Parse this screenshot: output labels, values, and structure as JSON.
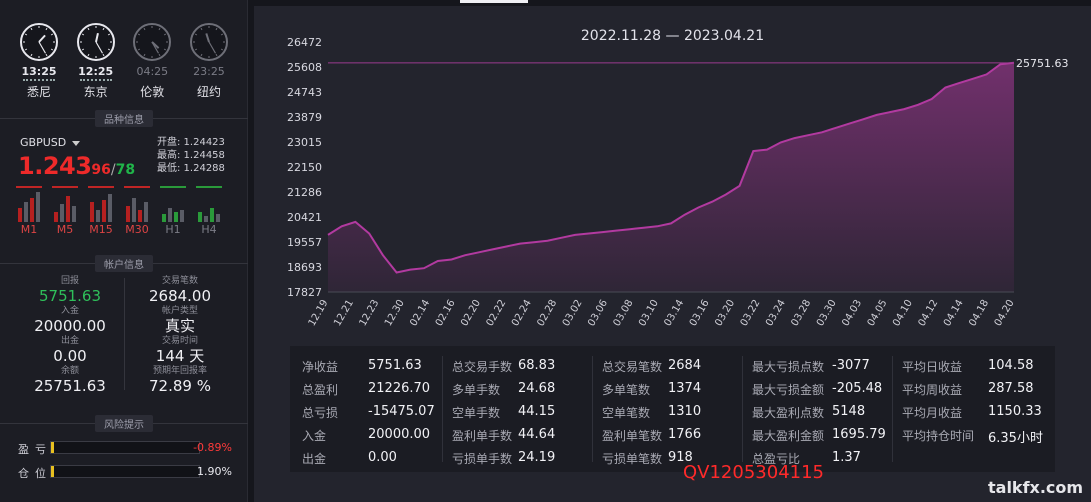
{
  "clocks": [
    {
      "time": "13:25",
      "city": "悉尼",
      "active": true,
      "h": 13,
      "m": 25
    },
    {
      "time": "12:25",
      "city": "东京",
      "active": true,
      "h": 12,
      "m": 25
    },
    {
      "time": "04:25",
      "city": "伦敦",
      "active": false,
      "h": 4,
      "m": 25
    },
    {
      "time": "23:25",
      "city": "纽约",
      "active": false,
      "h": 23,
      "m": 25
    }
  ],
  "sections": {
    "instrument": "品种信息",
    "account": "帐户信息",
    "risk": "风险提示"
  },
  "instrument": {
    "symbol": "GBPUSD",
    "bid_big": "1.243",
    "bid_small": "96",
    "slash": "/",
    "ask_small": "78",
    "open": "开盘: 1.24423",
    "high": "最高: 1.24458",
    "low": "最低: 1.24288",
    "timeframes": [
      {
        "label": "M1",
        "active": true
      },
      {
        "label": "M5",
        "active": true
      },
      {
        "label": "M15",
        "active": true
      },
      {
        "label": "M30",
        "active": true
      },
      {
        "label": "H1",
        "active": false
      },
      {
        "label": "H4",
        "active": false
      }
    ]
  },
  "account": {
    "left": [
      {
        "k": "回报",
        "v": "5751.63",
        "green": true
      },
      {
        "k": "入金",
        "v": "20000.00"
      },
      {
        "k": "出金",
        "v": "0.00"
      },
      {
        "k": "余额",
        "v": "25751.63"
      }
    ],
    "right": [
      {
        "k": "交易笔数",
        "v": "2684.00"
      },
      {
        "k": "帐户类型",
        "v": "真实"
      },
      {
        "k": "交易时间",
        "v": "144 天"
      },
      {
        "k": "预期年回报率",
        "v": "72.89 %"
      }
    ]
  },
  "risk": [
    {
      "label": "盈亏",
      "value": "-0.89%",
      "color": "#ff3a3a",
      "fill": 0.02
    },
    {
      "label": "仓位",
      "value": "1.90%",
      "color": "#e8e8ee",
      "fill": 0.02
    }
  ],
  "chart_data": {
    "type": "area",
    "title": "2022.11.28 — 2023.04.21",
    "ylim": [
      17827,
      26472
    ],
    "yticks": [
      "26472",
      "25608",
      "24743",
      "23879",
      "23015",
      "22150",
      "21286",
      "20421",
      "19557",
      "18693",
      "17827"
    ],
    "xticks": [
      "12.19",
      "12.21",
      "12.23",
      "12.30",
      "02.14",
      "02.16",
      "02.20",
      "02.22",
      "02.24",
      "02.28",
      "03.02",
      "03.06",
      "03.08",
      "03.10",
      "03.14",
      "03.16",
      "03.20",
      "03.22",
      "03.24",
      "03.28",
      "03.30",
      "04.03",
      "04.05",
      "04.10",
      "04.12",
      "04.14",
      "04.18",
      "04.20"
    ],
    "last_value": "25751.63",
    "reference_line": 25751.63,
    "values": [
      19800,
      20100,
      20250,
      19850,
      19100,
      18500,
      18600,
      18650,
      18900,
      18950,
      19100,
      19200,
      19300,
      19400,
      19500,
      19550,
      19600,
      19700,
      19800,
      19850,
      19900,
      19950,
      20000,
      20050,
      20100,
      20200,
      20500,
      20750,
      20950,
      21200,
      21500,
      22700,
      22750,
      23000,
      23150,
      23250,
      23350,
      23500,
      23650,
      23800,
      23950,
      24050,
      24150,
      24300,
      24500,
      24900,
      25050,
      25200,
      25350,
      25700,
      25751.63
    ],
    "color": "#b23aa0"
  },
  "stats": [
    [
      {
        "k": "净收益",
        "v": "5751.63"
      },
      {
        "k": "总盈利",
        "v": "21226.70"
      },
      {
        "k": "总亏损",
        "v": "-15475.07"
      },
      {
        "k": "入金",
        "v": "20000.00"
      },
      {
        "k": "出金",
        "v": "0.00"
      }
    ],
    [
      {
        "k": "总交易手数",
        "v": "68.83"
      },
      {
        "k": "多单手数",
        "v": "24.68"
      },
      {
        "k": "空单手数",
        "v": "44.15"
      },
      {
        "k": "盈利单手数",
        "v": "44.64"
      },
      {
        "k": "亏损单手数",
        "v": "24.19"
      }
    ],
    [
      {
        "k": "总交易笔数",
        "v": "2684"
      },
      {
        "k": "多单笔数",
        "v": "1374"
      },
      {
        "k": "空单笔数",
        "v": "1310"
      },
      {
        "k": "盈利单笔数",
        "v": "1766"
      },
      {
        "k": "亏损单笔数",
        "v": "918"
      }
    ],
    [
      {
        "k": "最大亏损点数",
        "v": "-3077"
      },
      {
        "k": "最大亏损金额",
        "v": "-205.48"
      },
      {
        "k": "最大盈利点数",
        "v": "5148"
      },
      {
        "k": "最大盈利金额",
        "v": "1695.79"
      },
      {
        "k": "总盈亏比",
        "v": "1.37"
      }
    ],
    [
      {
        "k": "平均日收益",
        "v": "104.58"
      },
      {
        "k": "平均周收益",
        "v": "287.58"
      },
      {
        "k": "平均月收益",
        "v": "1150.33"
      },
      {
        "k": "平均持仓时间",
        "v": "6.35小时"
      }
    ]
  ],
  "overlay_text": "QV1205304115",
  "watermark": "talkfx.com"
}
